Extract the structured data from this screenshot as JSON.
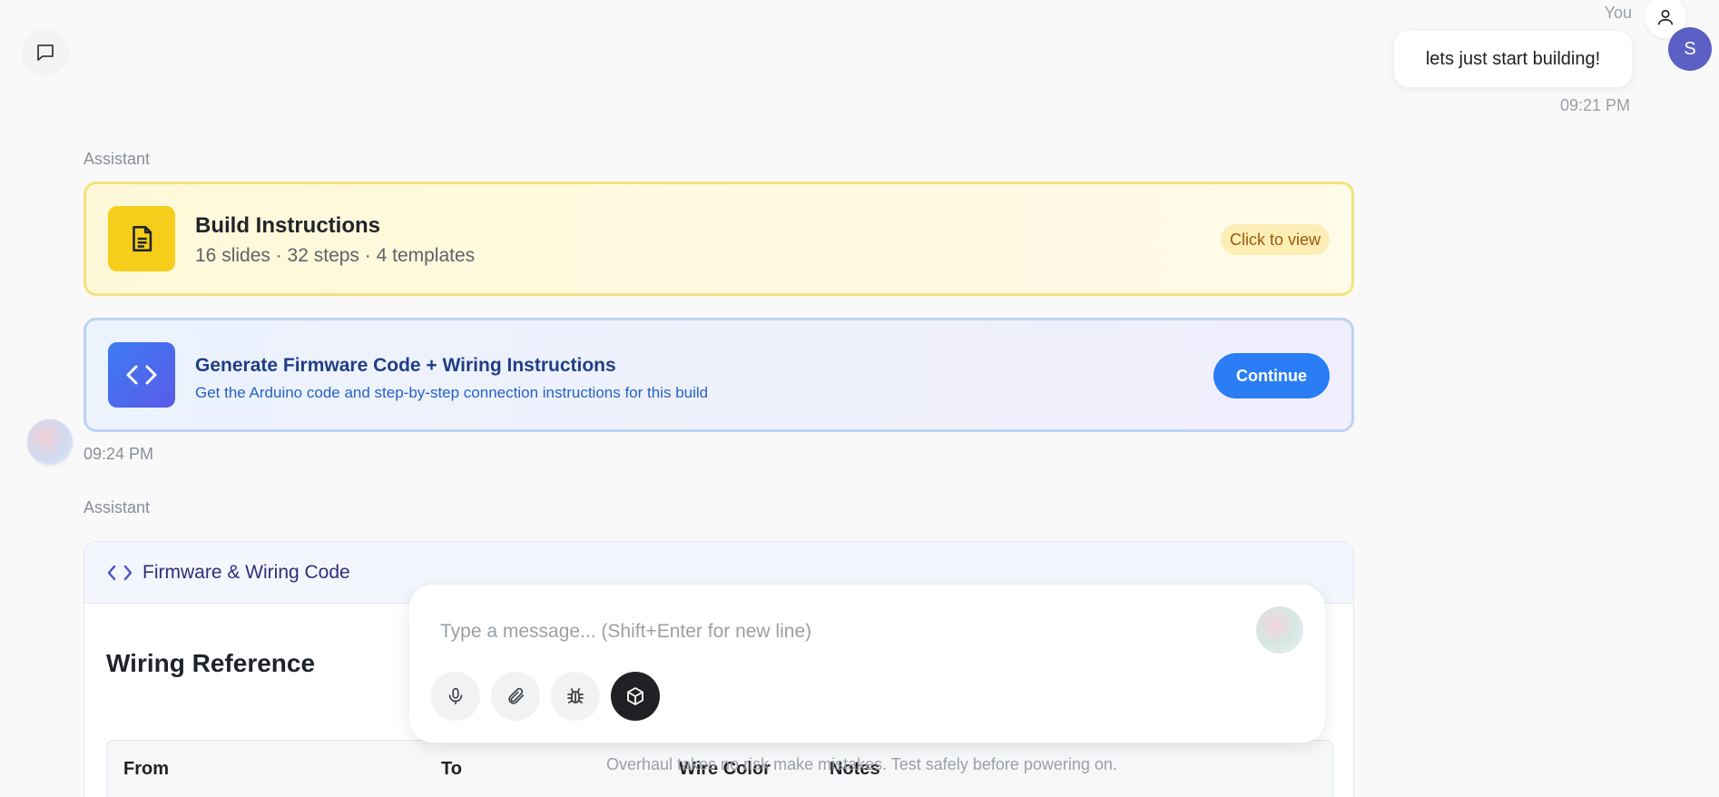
{
  "user_message": {
    "author": "You",
    "avatar_initial": "S",
    "text": "lets just start building!",
    "time": "09:21 PM"
  },
  "assistant_block_1": {
    "role": "Assistant",
    "build_card": {
      "title": "Build Instructions",
      "subtitle": "16 slides · 32 steps · 4 templates",
      "badge": "Click to view",
      "icon": "document-icon"
    },
    "firmware_card": {
      "title": "Generate Firmware Code + Wiring Instructions",
      "subtitle": "Get the Arduino code and step-by-step connection instructions for this build",
      "button": "Continue",
      "icon": "code-icon"
    },
    "time": "09:24 PM"
  },
  "assistant_block_2": {
    "role": "Assistant",
    "panel_title": "Firmware & Wiring Code",
    "section_title": "Wiring Reference",
    "table_headers": [
      "From",
      "To",
      "Wire Color",
      "Notes"
    ],
    "disclaimer": "Overhaul takes no risk make mistakes. Test safely before powering on."
  },
  "composer": {
    "placeholder": "Type a message... (Shift+Enter for new line)",
    "value": "",
    "tools": [
      "microphone-icon",
      "paperclip-icon",
      "bug-icon",
      "cube-icon"
    ]
  },
  "colors": {
    "accent_blue": "#2a7df4",
    "build_yellow": "#f6cd1a",
    "avatar_purple": "#5b60c4"
  }
}
